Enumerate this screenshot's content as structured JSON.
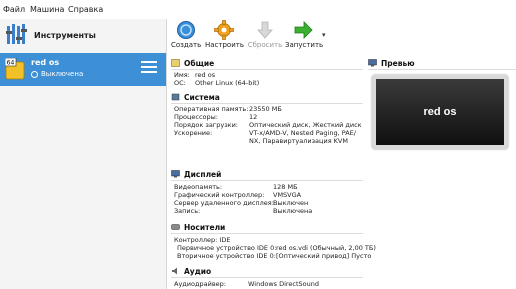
{
  "menu": [
    "Файл",
    "Машина",
    "Справка"
  ],
  "left": {
    "tools_label": "Инструменты",
    "vm": {
      "name": "red os",
      "state": "Выключена",
      "badge": "64"
    }
  },
  "toolbar": {
    "buttons": [
      {
        "label": "Создать",
        "icon": "create-icon"
      },
      {
        "label": "Настроить",
        "icon": "settings-gear-icon"
      },
      {
        "label": "Сбросить",
        "icon": "discard-arrow-icon",
        "disabled": true
      },
      {
        "label": "Запустить",
        "icon": "start-arrow-icon"
      }
    ],
    "dropdown": "▾"
  },
  "sections": {
    "general": {
      "title": "Общие",
      "rows": [
        {
          "k": "Имя:",
          "v": "red os"
        },
        {
          "k": "ОС:",
          "v": "Other Linux (64-bit)"
        }
      ]
    },
    "system": {
      "title": "Система",
      "rows": [
        {
          "k": "Оперативная память:",
          "v": "23550 МБ"
        },
        {
          "k": "Процессоры:",
          "v": "12"
        },
        {
          "k": "Порядок загрузки:",
          "v": "Оптический диск, Жесткий диск"
        },
        {
          "k": "Ускорение:",
          "v": "VT-x/AMD-V, Nested Paging, PAE/"
        },
        {
          "k": "",
          "v": "NX, Паравиртуализация KVM"
        }
      ]
    },
    "display": {
      "title": "Дисплей",
      "rows": [
        {
          "k": "Видеопамять:",
          "v": "128 МБ"
        },
        {
          "k": "Графический контроллер:",
          "v": "VMSVGA"
        },
        {
          "k": "Сервер удаленного дисплея:",
          "v": "Выключен"
        },
        {
          "k": "Запись:",
          "v": "Выключена"
        }
      ]
    },
    "storage": {
      "title": "Носители",
      "rows": [
        {
          "k": "Контроллер: IDE",
          "v": ""
        },
        {
          "k": "Первичное устройство IDE 0:",
          "v": "red os.vdi (Обычный, 2,00 ТБ)"
        },
        {
          "k": "Вторичное устройство IDE 0:",
          "v": "[Оптический привод] Пусто"
        }
      ]
    },
    "audio": {
      "title": "Аудио",
      "rows": [
        {
          "k": "Аудиодрайвер:",
          "v": "Windows DirectSound"
        }
      ]
    },
    "preview": {
      "title": "Превью",
      "screen_text": "red os"
    }
  },
  "colors": {
    "selection": "#3d8fd6",
    "create": "#3a8fd9",
    "settings": "#f0a020",
    "start": "#3cb030"
  }
}
